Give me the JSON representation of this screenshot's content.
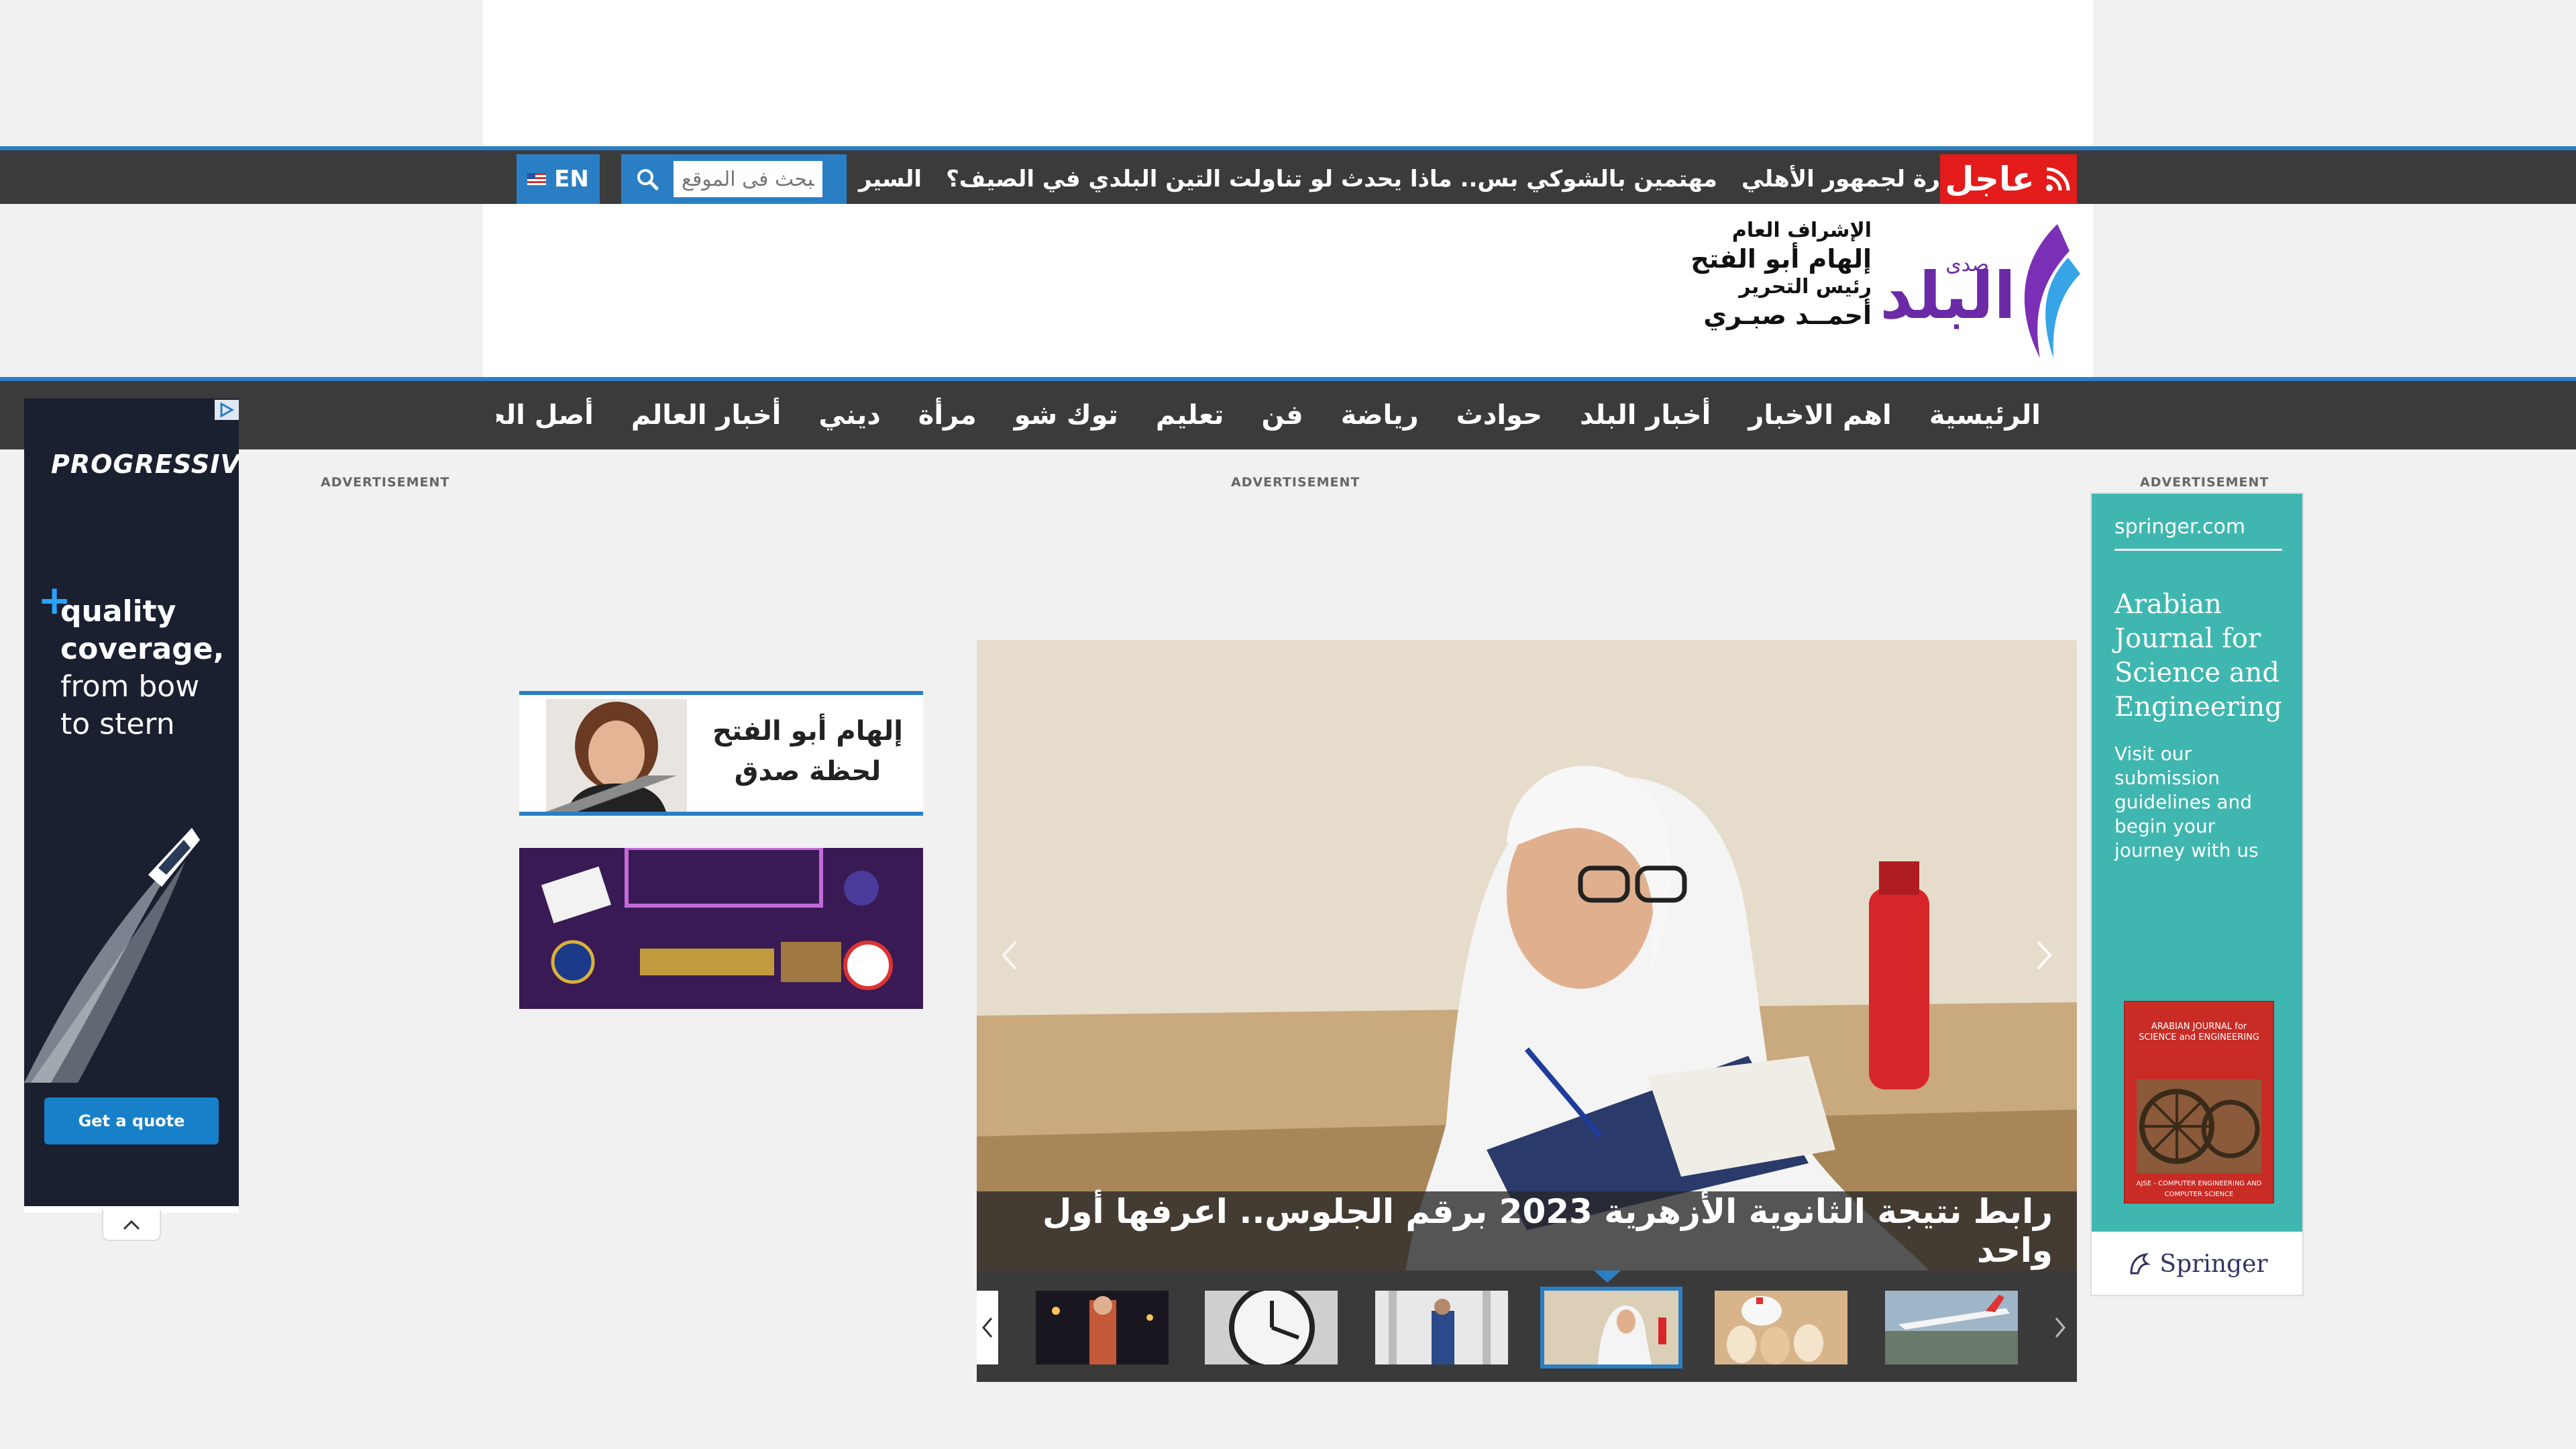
{
  "ticker": {
    "breaking_label": "عاجل",
    "items": [
      "شاهد بالأرقام.. حسام حسن يوجه رسالة مؤثرة لجمهور الأهلي",
      "مهتمين بالشوكي بس.. ماذا يحدث لو تناولت التين البلدي في الصيف؟",
      "السير"
    ]
  },
  "search": {
    "placeholder": "البحث فى الموقع"
  },
  "language": {
    "label": "EN"
  },
  "header": {
    "supervision_label": "الإشراف العام",
    "supervisor_name": "إلهام أبو الفتح",
    "editor_label": "رئيس التحرير",
    "editor_name": "أحمــد صبـري",
    "logo_small": "صدى",
    "logo_main": "البلد"
  },
  "nav": {
    "items": [
      "الرئيسية",
      "اهم الاخبار",
      "أخبار البلد",
      "حوادث",
      "رياضة",
      "فن",
      "تعليم",
      "توك شو",
      "مرأة",
      "ديني",
      "أخبار العالم",
      "أصل الحكاية"
    ]
  },
  "ads": {
    "label": "ADVERTISEMENT",
    "left": {
      "brand": "PROGRESSIVE",
      "line1": "quality",
      "line2": "coverage,",
      "line3": "from bow",
      "line4": "to stern",
      "cta": "Get a quote"
    },
    "right": {
      "domain": "springer.com",
      "title": "Arabian Journal for Science and Engineering",
      "desc": "Visit our submission guidelines and begin your journey with us",
      "book_title": "ARABIAN JOURNAL for SCIENCE and ENGINEERING",
      "book_sub": "AJSE - COMPUTER ENGINEERING AND COMPUTER SCIENCE",
      "publisher": "Springer"
    }
  },
  "sidebar": {
    "banner_title": "إلهام أبو الفتح",
    "banner_sub": "لحظة صدق"
  },
  "slider": {
    "caption": "رابط نتيجة الثانوية الأزهرية 2023 برقم الجلوس.. اعرفها أول واحد",
    "thumb_count": 6,
    "active_thumb": 3
  },
  "colors": {
    "accent": "#2a7fc4",
    "breaking": "#e31b1b",
    "bar": "#3b3b3b"
  }
}
